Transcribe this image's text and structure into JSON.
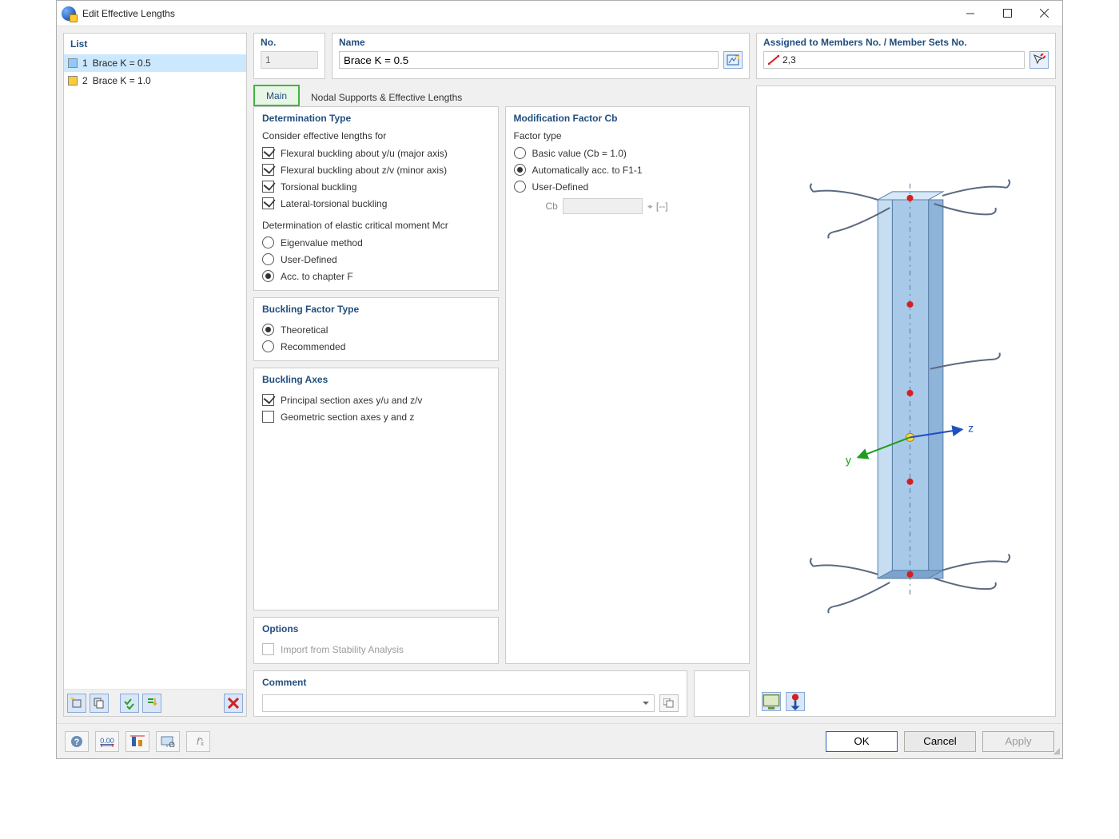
{
  "window": {
    "title": "Edit Effective Lengths"
  },
  "list": {
    "heading": "List",
    "items": [
      {
        "no": "1",
        "label": "Brace K = 0.5",
        "selected": true
      },
      {
        "no": "2",
        "label": "Brace K = 1.0",
        "selected": false
      }
    ]
  },
  "number": {
    "heading": "No.",
    "value": "1"
  },
  "name": {
    "heading": "Name",
    "value": "Brace K = 0.5"
  },
  "assigned": {
    "heading": "Assigned to Members No. / Member Sets No.",
    "value": "2,3"
  },
  "tabs": {
    "main": "Main",
    "nodal": "Nodal Supports & Effective Lengths"
  },
  "determination": {
    "heading": "Determination Type",
    "consider_label": "Consider effective lengths for",
    "cb": [
      {
        "label": "Flexural buckling about y/u (major axis)",
        "on": true
      },
      {
        "label": "Flexural buckling about z/v (minor axis)",
        "on": true
      },
      {
        "label": "Torsional buckling",
        "on": true
      },
      {
        "label": "Lateral-torsional buckling",
        "on": true
      }
    ],
    "mcr_label": "Determination of elastic critical moment Mcr",
    "mcr": [
      {
        "label": "Eigenvalue method",
        "on": false
      },
      {
        "label": "User-Defined",
        "on": false
      },
      {
        "label": "Acc. to chapter F",
        "on": true
      }
    ]
  },
  "modification": {
    "heading": "Modification Factor Cb",
    "type_label": "Factor type",
    "opts": [
      {
        "label": "Basic value (Cb = 1.0)",
        "on": false
      },
      {
        "label": "Automatically acc. to F1-1",
        "on": true
      },
      {
        "label": "User-Defined",
        "on": false
      }
    ],
    "cb_label": "Cb",
    "unit": "[--]"
  },
  "bf_type": {
    "heading": "Buckling Factor Type",
    "opts": [
      {
        "label": "Theoretical",
        "on": true
      },
      {
        "label": "Recommended",
        "on": false
      }
    ]
  },
  "axes": {
    "heading": "Buckling Axes",
    "cb": [
      {
        "label": "Principal section axes y/u and z/v",
        "on": true
      },
      {
        "label": "Geometric section axes y and z",
        "on": false
      }
    ]
  },
  "options": {
    "heading": "Options",
    "import_label": "Import from Stability Analysis"
  },
  "comment": {
    "heading": "Comment"
  },
  "preview": {
    "y_label": "y",
    "z_label": "z"
  },
  "buttons": {
    "ok": "OK",
    "cancel": "Cancel",
    "apply": "Apply"
  }
}
